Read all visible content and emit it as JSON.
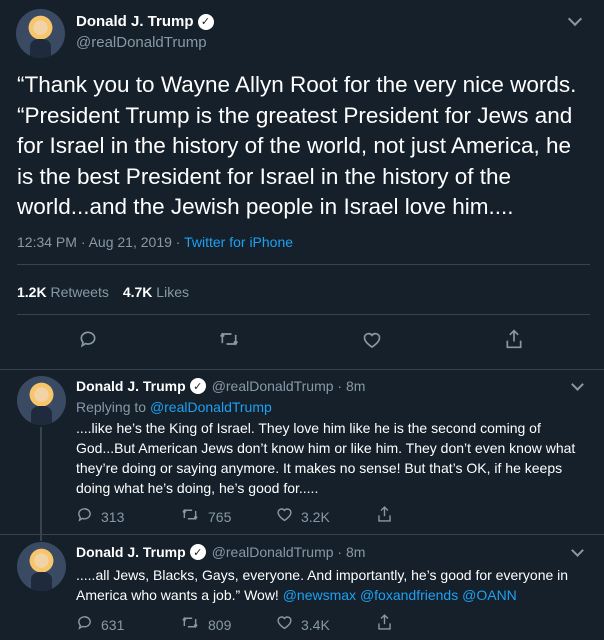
{
  "main": {
    "name": "Donald J. Trump",
    "handle": "@realDonaldTrump",
    "text": "“Thank you to Wayne Allyn Root for the very nice words. “President Trump is the greatest President for Jews and for Israel in the history of the world, not just America, he is the best President for Israel in the history of the world...and the Jewish people in Israel love him....",
    "time": "12:34 PM · Aug 21, 2019 ·",
    "source": "Twitter for iPhone",
    "retweets_count": "1.2K",
    "retweets_label": "Retweets",
    "likes_count": "4.7K",
    "likes_label": "Likes"
  },
  "replies": [
    {
      "name": "Donald J. Trump",
      "handle_time": "@realDonaldTrump · 8m",
      "replying_to_label": "Replying to",
      "replying_to_handle": "@realDonaldTrump",
      "text": "....like he’s the King of Israel. They love him like he is the second coming of God...But American Jews don’t know him or like him. They don’t even know what they’re doing or saying anymore. It makes no sense! But that’s OK, if he keeps doing what he’s doing, he’s good for.....",
      "replies": "313",
      "retweets": "765",
      "likes": "3.2K"
    },
    {
      "name": "Donald J. Trump",
      "handle_time": "@realDonaldTrump · 8m",
      "text_part": ".....all Jews, Blacks, Gays, everyone. And importantly, he’s good for everyone in America who wants a job.” Wow!",
      "mention1": "@newsmax",
      "mention2": "@foxandfriends",
      "mention3": "@OANN",
      "replies": "631",
      "retweets": "809",
      "likes": "3.4K"
    }
  ],
  "icons": {
    "reply": "reply-icon",
    "retweet": "retweet-icon",
    "like": "heart-icon",
    "share": "share-icon"
  },
  "colors": {
    "background": "#15202b",
    "accent": "#1da1f2",
    "muted": "#8899a6",
    "divider": "#38444d"
  }
}
